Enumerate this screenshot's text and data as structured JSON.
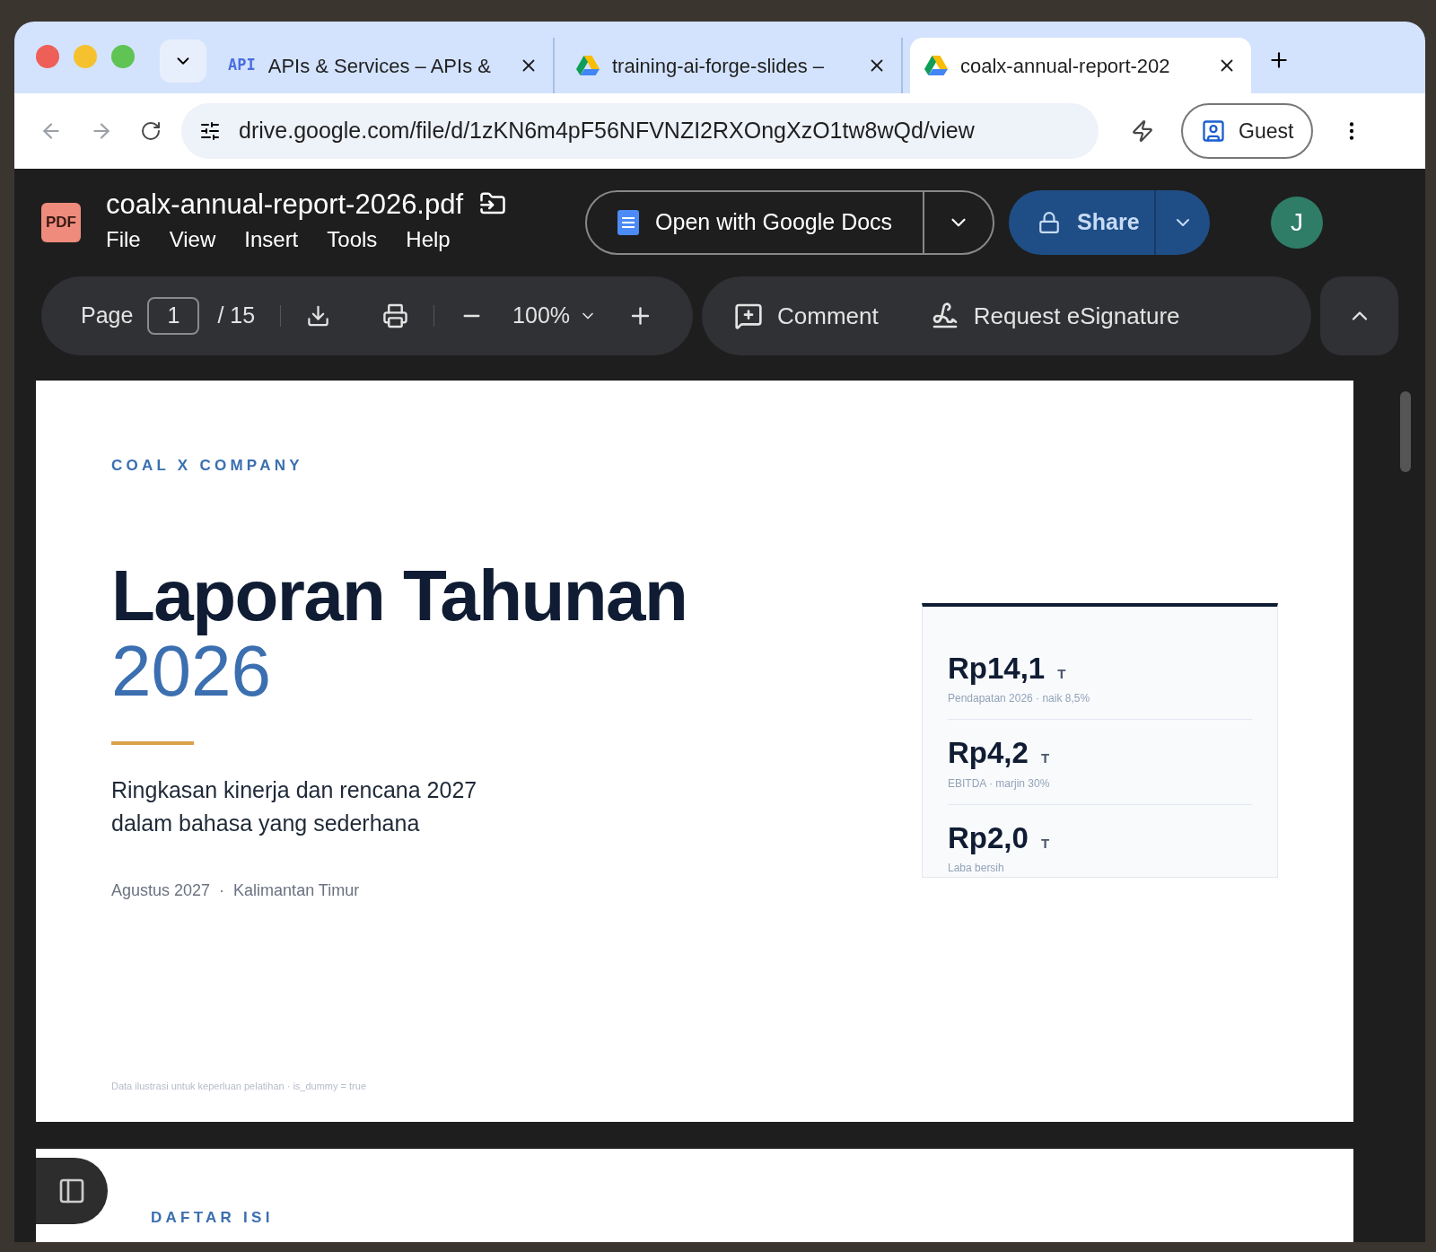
{
  "tabs": [
    {
      "kind": "api",
      "favicon_text": "API",
      "title": "APIs & Services – APIs &",
      "selected": false
    },
    {
      "kind": "drive",
      "title": "training-ai-forge-slides –",
      "selected": false
    },
    {
      "kind": "drive",
      "title": "coalx-annual-report-202",
      "selected": true
    }
  ],
  "address_bar": {
    "url": "drive.google.com/file/d/1zKN6m4pF56NFVNZI2RXOngXzO1tw8wQd/view"
  },
  "profile": {
    "label": "Guest"
  },
  "file": {
    "badge": "PDF",
    "name": "coalx-annual-report-2026.pdf",
    "menu": [
      "File",
      "View",
      "Insert",
      "Tools",
      "Help"
    ]
  },
  "open_with": {
    "label": "Open with Google Docs"
  },
  "share": {
    "label": "Share"
  },
  "avatar": {
    "initial": "J"
  },
  "toolbar": {
    "page_label": "Page",
    "page_value": "1",
    "page_total": "/ 15",
    "zoom": "100%",
    "comment": "Comment",
    "esign": "Request eSignature"
  },
  "page1": {
    "eyebrow": "COAL X COMPANY",
    "title": "Laporan Tahunan",
    "year": "2026",
    "subtitle": "Ringkasan kinerja dan rencana 2027\ndalam bahasa yang sederhana",
    "date": "Agustus 2027",
    "separator": "·",
    "location": "Kalimantan Timur",
    "stats": [
      {
        "value": "Rp14,1",
        "unit": "T",
        "caption": "Pendapatan 2026 · naik 8,5%"
      },
      {
        "value": "Rp4,2",
        "unit": "T",
        "caption": "EBITDA · marjin 30%"
      },
      {
        "value": "Rp2,0",
        "unit": "T",
        "caption": "Laba bersih"
      }
    ],
    "footnote": "Data ilustrasi untuk keperluan pelatihan · is_dummy = true"
  },
  "page2": {
    "eyebrow": "DAFTAR ISI"
  }
}
